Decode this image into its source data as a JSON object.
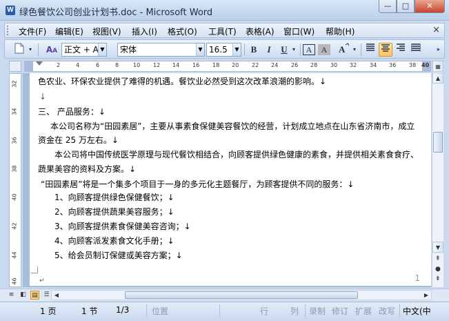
{
  "window": {
    "title": "绿色餐饮公司创业计划书.doc - Microsoft Word",
    "app_icon": "W",
    "controls": {
      "minimize": "—",
      "maximize": "□",
      "close": "✕"
    }
  },
  "menu": {
    "items": [
      "文件(F)",
      "编辑(E)",
      "视图(V)",
      "插入(I)",
      "格式(O)",
      "工具(T)",
      "表格(A)",
      "窗口(W)",
      "帮助(H)"
    ],
    "close_doc": "×"
  },
  "toolbar": {
    "style_value": "正文 + Aria",
    "font_value": "宋体",
    "size_value": "16.5",
    "bold": "B",
    "italic": "I",
    "underline": "U",
    "char_border": "A",
    "char_shading": "A",
    "highlight": "A",
    "overflow": "▸"
  },
  "ruler": {
    "numbers": [
      "2",
      "4",
      "6",
      "8",
      "10",
      "12",
      "14",
      "16",
      "18",
      "20",
      "22",
      "24",
      "26",
      "28",
      "30",
      "32",
      "34",
      "36",
      "38",
      "40"
    ]
  },
  "vruler": {
    "numbers": [
      "32",
      "34",
      "36",
      "38",
      "40",
      "42",
      "44",
      "46"
    ]
  },
  "document": {
    "lines": [
      "色农业、环保农业提供了难得的机遇。餐饮业必然受到这次改革浪潮的影响。↓",
      "↓",
      "三、 产品服务：↓",
      "本公司名称为“田园素居”，主要从事素食保健美容餐饮的经营，计划成立地点在山东省济南市，成立",
      "资金在 25 万左右。↓",
      "本公司将中国传统医学原理与现代餐饮相结合，向顾客提供绿色健康的素食，并提供相关素食食疗、",
      "蔬果美容的资料及方案。↓",
      "“田园素居”将是一个集多个项目于一身的多元化主题餐厅，为顾客提供不同的服务：↓",
      "1、向顾客提供绿色保健餐饮；↓",
      "2、向顾客提供蔬果美容服务；↓",
      "3、向顾客提供素食保健美容咨询；↓",
      "4、向顾客派发素食文化手册；↓",
      "5、给会员制订保健或美容方案；↓"
    ],
    "page_number": "1",
    "paragraph_mark": "↵"
  },
  "statusbar": {
    "page": "1 页",
    "section": "1 节",
    "page_of": "1/3",
    "position": "位置",
    "line": "行",
    "column": "列",
    "record": "录制",
    "revision": "修订",
    "extend": "扩展",
    "overtype": "改写",
    "language": "中文(中"
  },
  "colors": {
    "accent": "#ffc45d",
    "frame": "#c9d9ee",
    "ruler_dark": "#a9bdd9"
  }
}
